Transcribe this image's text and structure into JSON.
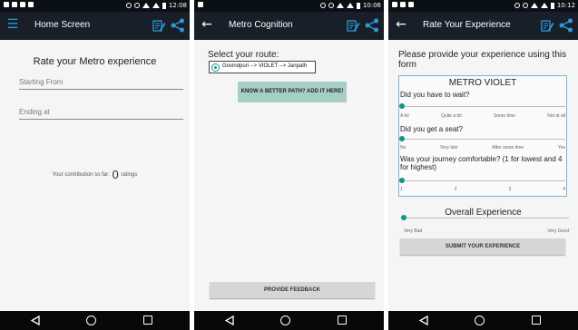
{
  "screens": [
    {
      "status_time": "12:08",
      "title": "Home Screen",
      "nav_icon": "menu-icon",
      "heading": "Rate your Metro experience",
      "starting_placeholder": "Starting From",
      "ending_placeholder": "Ending at",
      "contribution_prefix": "Your contribution so far:",
      "contribution_count": "0",
      "contribution_suffix": "ratings"
    },
    {
      "status_time": "10:06",
      "title": "Metro Cognition",
      "nav_icon": "back-arrow-icon",
      "select_label": "Select your route:",
      "route_option": "Govindpuri --> VIOLET --> Janpath",
      "better_path_button": "KNOW A BETTER PATH? ADD IT HERE!",
      "feedback_button": "PROVIDE FEEDBACK"
    },
    {
      "status_time": "10:12",
      "title": "Rate Your Experience",
      "nav_icon": "back-arrow-icon",
      "intro": "Please provide your experience using this form",
      "form_title": "METRO VIOLET",
      "questions": [
        {
          "text": "Did you have to wait?",
          "labels": [
            "A lot",
            "Quite a bit",
            "Some time",
            "Not at all"
          ],
          "value": 0
        },
        {
          "text": "Did you get a seat?",
          "labels": [
            "No",
            "Very late",
            "After some time",
            "Yes"
          ],
          "value": 0
        },
        {
          "text": "Was your journey comfortable? (1 for lowest and 4 for highest)",
          "labels": [
            "1",
            "2",
            "3",
            "4"
          ],
          "value": 0
        }
      ],
      "overall_label": "Overall Experience",
      "overall_low": "Very Bad",
      "overall_high": "Very Good",
      "overall_value": 0,
      "submit_button": "SUBMIT YOUR EXPERIENCE"
    }
  ],
  "colors": {
    "statusbar": "#0b1014",
    "appbar": "#181f29",
    "accent_blue": "#2b9ad8",
    "teal": "#129585",
    "better_path_bg": "#a6cec5",
    "button_grey": "#d6d6d6",
    "navbar": "#080808"
  }
}
